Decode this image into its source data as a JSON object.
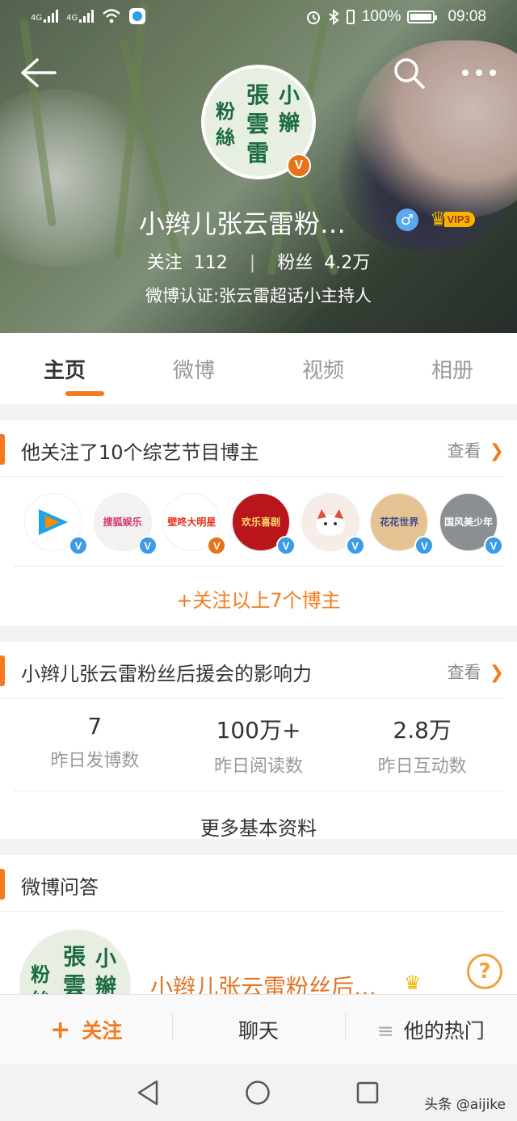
{
  "status_bar": {
    "net1": "4G",
    "net2": "4G",
    "battery_pct": "100%",
    "time": "09:08"
  },
  "profile": {
    "name": "小辫儿张云雷粉…",
    "vip_level": "VIP3",
    "gender_symbol": "♂",
    "following_label": "关注",
    "following_count": "112",
    "followers_label": "粉丝",
    "followers_count": "4.2万",
    "verification": "微博认证:张云雷超话小主持人",
    "avatar_chars": [
      "小",
      "辮",
      "張",
      "雲",
      "雷",
      "粉",
      "絲"
    ]
  },
  "tabs": [
    {
      "label": "主页",
      "active": true
    },
    {
      "label": "微博",
      "active": false
    },
    {
      "label": "视频",
      "active": false
    },
    {
      "label": "相册",
      "active": false
    }
  ],
  "follows_card": {
    "title": "他关注了10个综艺节目博主",
    "more": "查看",
    "avatars": [
      {
        "text": "",
        "bg": "#ffffff",
        "color": "#1aa3e8",
        "badge": "blue"
      },
      {
        "text": "搜狐娱乐",
        "bg": "#f2f2f2",
        "color": "#d6336c",
        "badge": "blue"
      },
      {
        "text": "壁咚大明星",
        "bg": "#ffffff",
        "color": "#e2321a",
        "badge": "gold"
      },
      {
        "text": "欢乐喜剧",
        "bg": "#b8161b",
        "color": "#ffd86a",
        "badge": "blue"
      },
      {
        "text": "",
        "bg": "#f6ede8",
        "color": "#e0503c",
        "badge": "blue"
      },
      {
        "text": "花花世界",
        "bg": "#e5c291",
        "color": "#3a4b8f",
        "badge": "blue"
      },
      {
        "text": "国风美少年",
        "bg": "#8a8f93",
        "color": "#ffffff",
        "badge": "blue"
      }
    ],
    "follow_all": "+关注以上7个博主"
  },
  "influence_card": {
    "title": "小辫儿张云雷粉丝后援会的影响力",
    "more": "查看",
    "metrics": [
      {
        "value": "7",
        "label": "昨日发博数"
      },
      {
        "value": "100万+",
        "label": "昨日阅读数"
      },
      {
        "value": "2.8万",
        "label": "昨日互动数"
      }
    ],
    "more_info": "更多基本资料"
  },
  "qa_card": {
    "title": "微博问答",
    "item_name": "小辫儿张云雷粉丝后…"
  },
  "bottom_bar": {
    "follow": "关注",
    "chat": "聊天",
    "hot": "他的热门"
  },
  "watermark": "头条 @aijike",
  "colors": {
    "accent": "#f47a1f",
    "verified_gold": "#e8711a",
    "verified_blue": "#3a9be8"
  }
}
